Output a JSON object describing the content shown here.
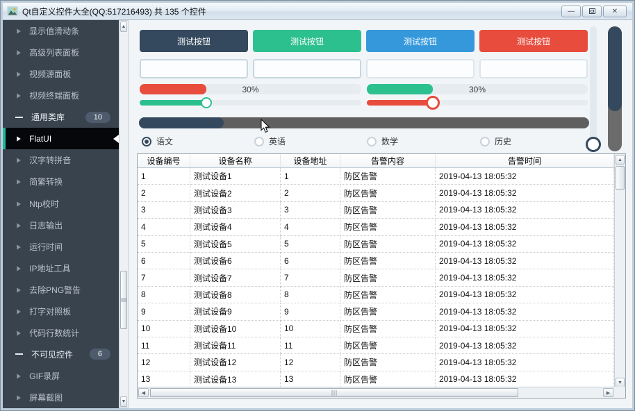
{
  "window": {
    "title": "Qt自定义控件大全(QQ:517216493) 共 135 个控件",
    "controls": {
      "minimize": "—",
      "maximize": "□",
      "close": "✕"
    }
  },
  "colors": {
    "accent": "#1abc9c",
    "navy": "#34495e",
    "green": "#2cc08e",
    "blue": "#3598db",
    "red": "#e74c3c"
  },
  "sidebar": {
    "items": [
      {
        "label": "显示值滑动条",
        "type": "item"
      },
      {
        "label": "高级列表面板",
        "type": "item"
      },
      {
        "label": "视频源面板",
        "type": "item"
      },
      {
        "label": "视频终端面板",
        "type": "item"
      },
      {
        "label": "通用类库",
        "type": "group",
        "badge": "10"
      },
      {
        "label": "FlatUI",
        "type": "item",
        "selected": true
      },
      {
        "label": "汉字转拼音",
        "type": "item"
      },
      {
        "label": "简繁转换",
        "type": "item"
      },
      {
        "label": "Ntp校时",
        "type": "item"
      },
      {
        "label": "日志输出",
        "type": "item"
      },
      {
        "label": "运行时间",
        "type": "item"
      },
      {
        "label": "IP地址工具",
        "type": "item"
      },
      {
        "label": "去除PNG警告",
        "type": "item"
      },
      {
        "label": "打字对照板",
        "type": "item"
      },
      {
        "label": "代码行数统计",
        "type": "item"
      },
      {
        "label": "不可见控件",
        "type": "group",
        "badge": "6"
      },
      {
        "label": "GIF录屏",
        "type": "item"
      },
      {
        "label": "屏幕截图",
        "type": "item"
      }
    ]
  },
  "panel": {
    "buttons": [
      {
        "label": "测试按钮",
        "color": "#34495e"
      },
      {
        "label": "测试按钮",
        "color": "#2cc08e"
      },
      {
        "label": "测试按钮",
        "color": "#3598db"
      },
      {
        "label": "测试按钮",
        "color": "#e74c3c"
      }
    ],
    "inputs": [
      {
        "value": "",
        "placeholder": ""
      },
      {
        "value": "",
        "placeholder": ""
      },
      {
        "value": "",
        "placeholder": ""
      },
      {
        "value": "",
        "placeholder": ""
      }
    ],
    "progressbars": [
      {
        "label": "30%",
        "percent": 30,
        "color": "#e74c3c"
      },
      {
        "label": "30%",
        "percent": 30,
        "color": "#2cc08e"
      }
    ],
    "sliders": [
      {
        "percent": 30,
        "color": "#2cc08e"
      },
      {
        "percent": 30,
        "color": "#e74c3c"
      }
    ],
    "scrollbar_slider": {
      "percent": 19,
      "fill": "#34495e",
      "track": "#5f5f5f"
    },
    "radios": [
      {
        "label": "语文",
        "checked": true
      },
      {
        "label": "英语",
        "checked": false
      },
      {
        "label": "数学",
        "checked": false
      },
      {
        "label": "历史",
        "checked": false
      }
    ],
    "vprogress": {
      "percent": 68,
      "fill": "#34495e",
      "track": "#6b6b6b"
    }
  },
  "table": {
    "columns": [
      "设备编号",
      "设备名称",
      "设备地址",
      "告警内容",
      "告警时间"
    ],
    "rows": [
      [
        "1",
        "测试设备1",
        "1",
        "防区告警",
        "2019-04-13 18:05:32"
      ],
      [
        "2",
        "测试设备2",
        "2",
        "防区告警",
        "2019-04-13 18:05:32"
      ],
      [
        "3",
        "测试设备3",
        "3",
        "防区告警",
        "2019-04-13 18:05:32"
      ],
      [
        "4",
        "测试设备4",
        "4",
        "防区告警",
        "2019-04-13 18:05:32"
      ],
      [
        "5",
        "测试设备5",
        "5",
        "防区告警",
        "2019-04-13 18:05:32"
      ],
      [
        "6",
        "测试设备6",
        "6",
        "防区告警",
        "2019-04-13 18:05:32"
      ],
      [
        "7",
        "测试设备7",
        "7",
        "防区告警",
        "2019-04-13 18:05:32"
      ],
      [
        "8",
        "测试设备8",
        "8",
        "防区告警",
        "2019-04-13 18:05:32"
      ],
      [
        "9",
        "测试设备9",
        "9",
        "防区告警",
        "2019-04-13 18:05:32"
      ],
      [
        "10",
        "测试设备10",
        "10",
        "防区告警",
        "2019-04-13 18:05:32"
      ],
      [
        "11",
        "测试设备11",
        "11",
        "防区告警",
        "2019-04-13 18:05:32"
      ],
      [
        "12",
        "测试设备12",
        "12",
        "防区告警",
        "2019-04-13 18:05:32"
      ],
      [
        "13",
        "测试设备13",
        "13",
        "防区告警",
        "2019-04-13 18:05:32"
      ]
    ]
  }
}
